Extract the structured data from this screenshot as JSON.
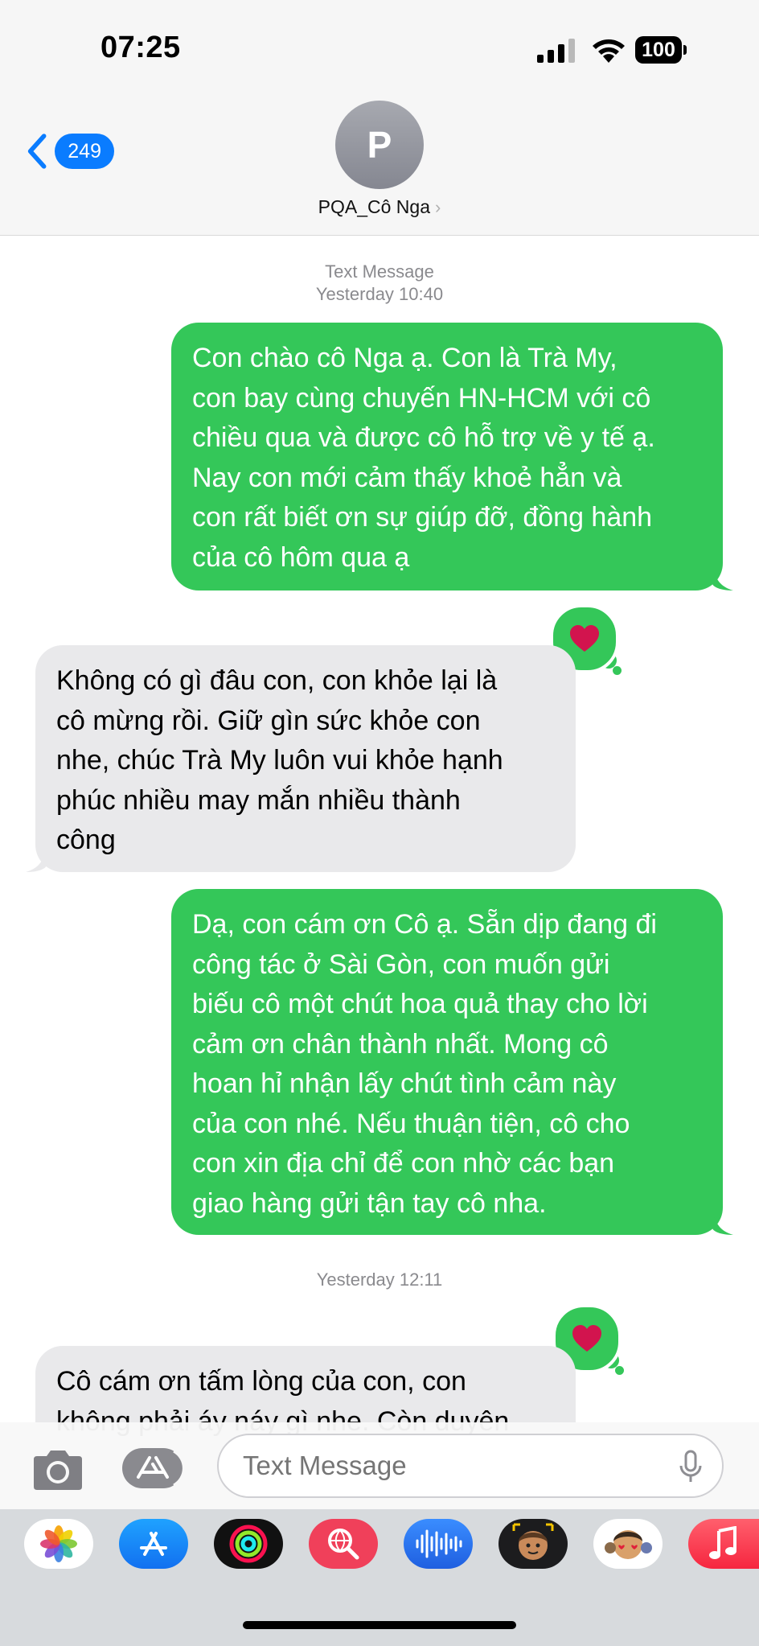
{
  "status_bar": {
    "time": "07:25",
    "battery": "100"
  },
  "header": {
    "back_count": "249",
    "avatar_initial": "P",
    "contact_name": "PQA_Cô Nga"
  },
  "thread": {
    "service_label": "Text Message",
    "first_timestamp": "Yesterday 10:40",
    "second_timestamp": "Yesterday 12:11",
    "messages": [
      {
        "direction": "outgoing",
        "lines": [
          "Con chào cô Nga ạ. Con là Trà My,",
          "con bay cùng chuyến HN-HCM với cô",
          "chiều qua và được cô hỗ trợ về y tế ạ.",
          "Nay con mới cảm thấy khoẻ hẳn và",
          "con rất biết ơn sự giúp đỡ, đồng hành",
          "của cô hôm qua ạ"
        ],
        "reaction": "heart"
      },
      {
        "direction": "incoming",
        "lines": [
          "Không có gì đâu con, con khỏe lại là",
          "cô mừng rồi. Giữ gìn sức khỏe con",
          "nhe, chúc Trà My luôn vui khỏe hạnh",
          "phúc nhiều may mắn nhiều thành",
          "công"
        ]
      },
      {
        "direction": "outgoing",
        "lines": [
          "Dạ, con cám ơn Cô ạ. Sẵn dịp đang đi",
          "công tác ở Sài Gòn, con muốn gửi",
          "biếu cô một chút hoa quả thay cho lời",
          "cảm ơn chân thành nhất. Mong cô",
          "hoan hỉ nhận lấy chút tình cảm này",
          "của con nhé. Nếu thuận tiện, cô cho",
          "con xin địa chỉ để con nhờ các bạn",
          "giao hàng gửi tận tay cô nha."
        ],
        "reaction": "heart"
      },
      {
        "direction": "incoming",
        "lines": [
          "Cô cám ơn tấm lòng của con, con",
          "không phải áy náy gì nhe. Còn duyên"
        ]
      }
    ]
  },
  "input": {
    "placeholder": "Text Message"
  },
  "app_drawer": {
    "apps": [
      "Photos",
      "App Store",
      "Activity",
      "Search Images",
      "Audio",
      "Memoji Stickers",
      "Memoji",
      "Music"
    ]
  },
  "colors": {
    "outgoing_bubble": "#34c759",
    "incoming_bubble": "#e9e9eb",
    "accent": "#0a7cff",
    "heart": "#d2144e"
  }
}
